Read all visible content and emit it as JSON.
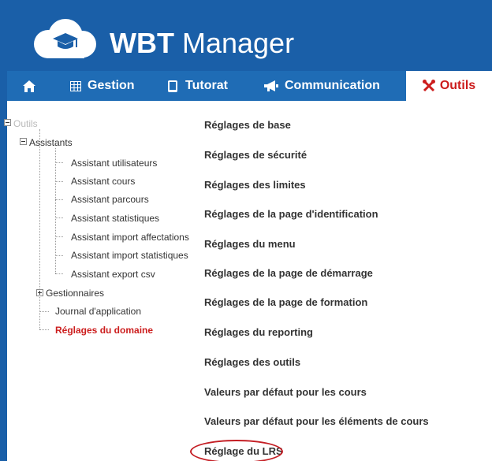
{
  "app": {
    "brand": "WBT",
    "name": " Manager"
  },
  "nav": {
    "home_icon": "home-icon",
    "gestion": "Gestion",
    "tutorat": "Tutorat",
    "communication": "Communication",
    "outils": "Outils",
    "active": "Outils",
    "active_color": "#cc1d1d"
  },
  "tree": {
    "root": "Outils",
    "assistants": "Assistants",
    "assistant_items": [
      "Assistant utilisateurs",
      "Assistant cours",
      "Assistant parcours",
      "Assistant statistiques",
      "Assistant import affectations",
      "Assistant import statistiques",
      "Assistant export csv"
    ],
    "gestionnaires": "Gestionnaires",
    "journal": "Journal d'application",
    "reglages_domaine": "Réglages du domaine"
  },
  "settings_menu": [
    "Réglages de base",
    "Réglages de sécurité",
    "Réglages des limites",
    "Réglages de la page d'identification",
    "Réglages du menu",
    "Réglages de la page de démarrage",
    "Réglages de la page de formation",
    "Réglages du reporting",
    "Réglages des outils",
    "Valeurs par défaut pour les cours",
    "Valeurs par défaut pour les éléments de cours",
    "Réglage du LRS"
  ],
  "colors": {
    "brand_blue": "#1a5fa8",
    "nav_blue": "#1f6cb5",
    "highlight_red": "#c41e24"
  }
}
